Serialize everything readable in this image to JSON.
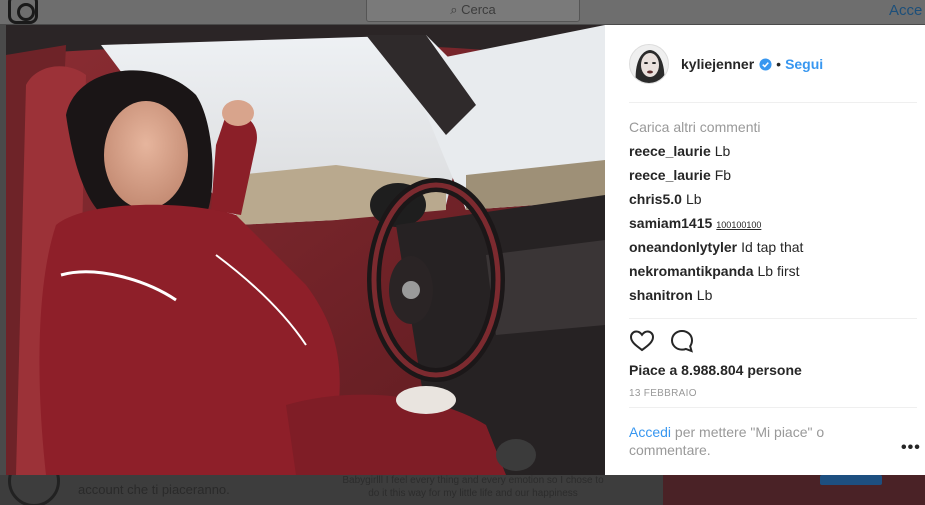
{
  "background": {
    "search_placeholder": "Cerca",
    "login_link": "Acce",
    "bottom_text": "account che ti piaceranno.",
    "bottom_caption": "Babygirlll I feel every thing and every emotion so I chose to do it this way for my little life and our happiness"
  },
  "post": {
    "username": "kyliejenner",
    "separator": "•",
    "follow_label": "Segui",
    "load_more": "Carica altri commenti",
    "comments": [
      {
        "user": "reece_laurie",
        "text": "Lb"
      },
      {
        "user": "reece_laurie",
        "text": "Fb"
      },
      {
        "user": "chris5.0",
        "text": "Lb"
      },
      {
        "user": "samiam1415",
        "text": "100100100"
      },
      {
        "user": "oneandonlytyler",
        "text": "Id tap that"
      },
      {
        "user": "nekromantikpanda",
        "text": "Lb first"
      },
      {
        "user": "shanitron",
        "text": "Lb"
      }
    ],
    "likes_text": "Piace a 8.988.804 persone",
    "date": "13 FEBBRAIO",
    "login_link": "Accedi",
    "login_text": " per mettere \"Mi piace\" o commentare.",
    "more_label": "•••",
    "carousel": {
      "count": 2,
      "active": 1
    }
  },
  "colors": {
    "accent": "#3897f0",
    "text": "#262626",
    "muted": "#999999"
  },
  "icons": [
    "heart-icon",
    "comment-icon",
    "verified-badge-icon",
    "more-options-icon"
  ]
}
